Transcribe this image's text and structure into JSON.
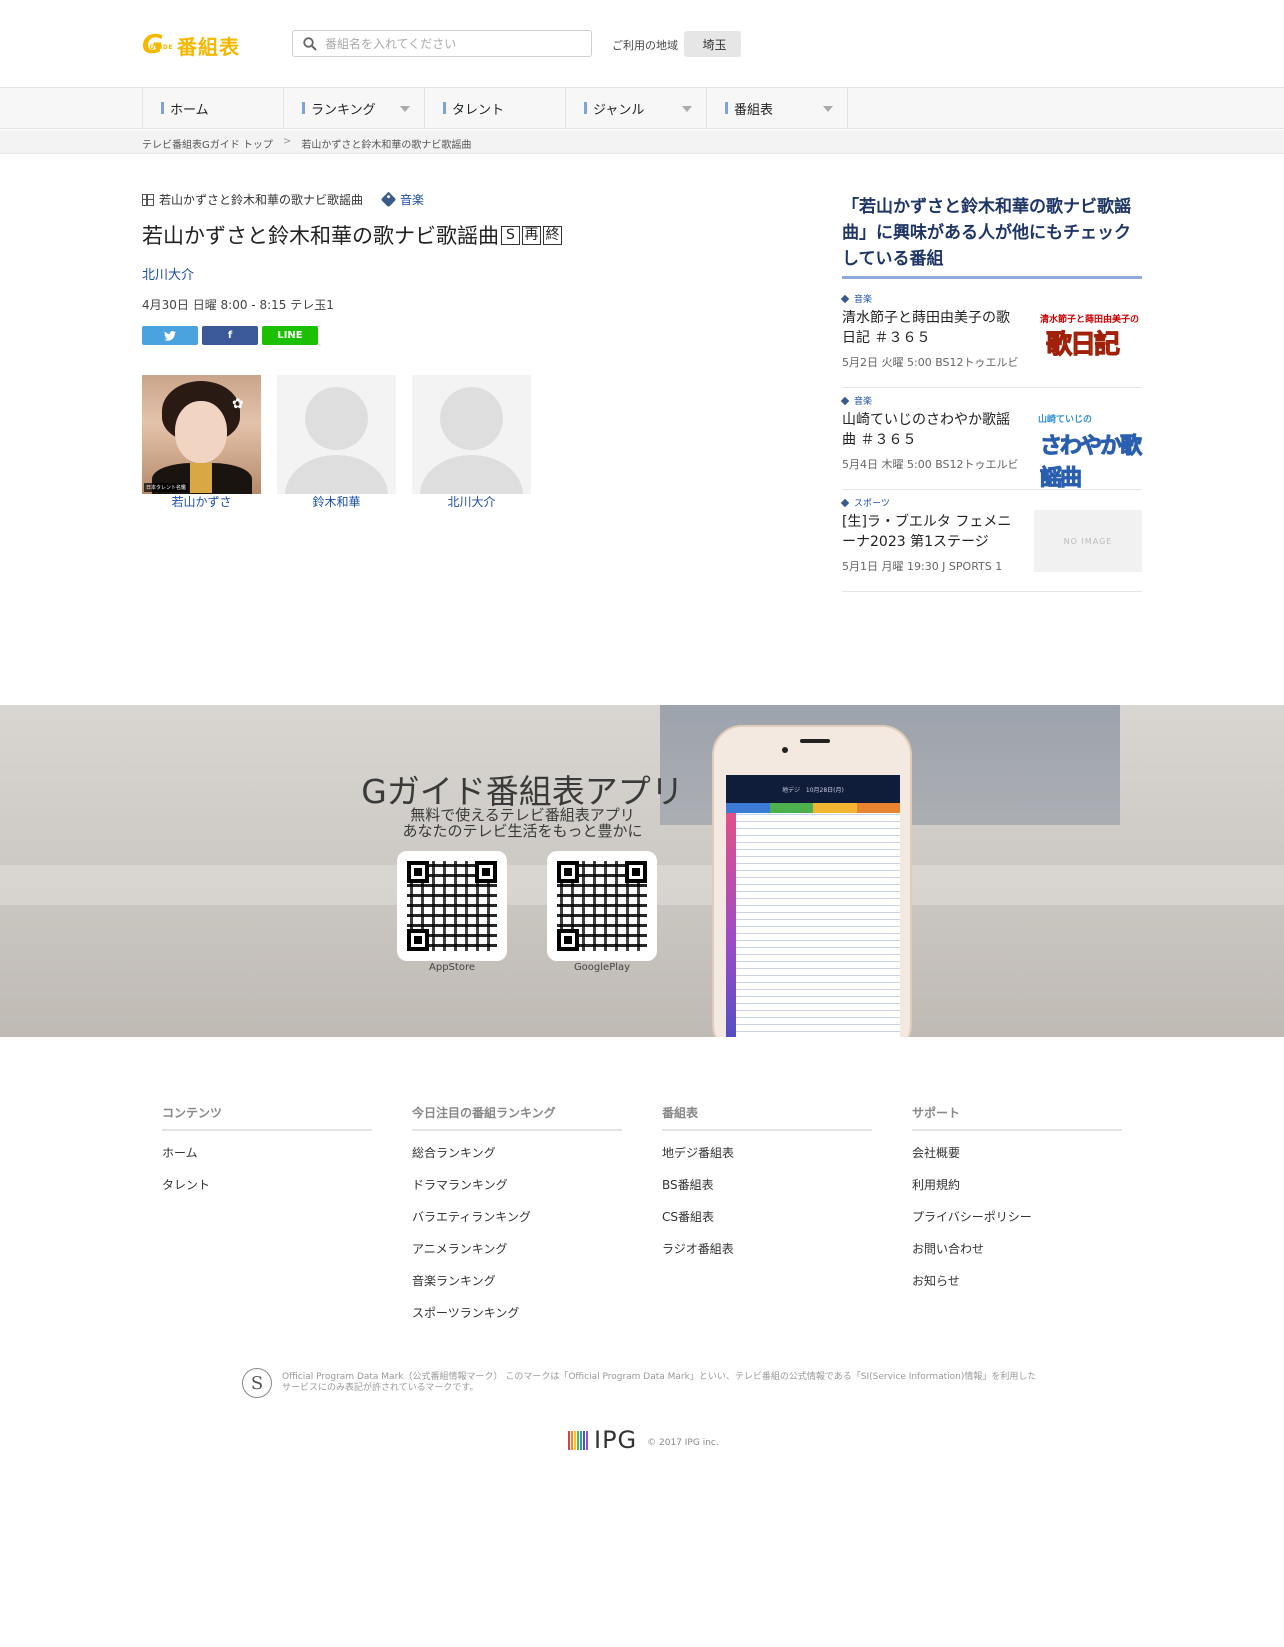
{
  "header": {
    "logo_mark": "G",
    "logo_guide": "GUIDE",
    "logo_text": "番組表",
    "search_placeholder": "番組名を入れてください",
    "region_label": "ご利用の地域",
    "region_value": "埼玉"
  },
  "nav": {
    "items": [
      {
        "label": "ホーム",
        "dropdown": false
      },
      {
        "label": "ランキング",
        "dropdown": true
      },
      {
        "label": "タレント",
        "dropdown": false
      },
      {
        "label": "ジャンル",
        "dropdown": true
      },
      {
        "label": "番組表",
        "dropdown": true
      }
    ]
  },
  "breadcrumb": {
    "home": "テレビ番組表Gガイド トップ",
    "sep": ">",
    "current": "若山かずさと鈴木和華の歌ナビ歌謡曲"
  },
  "program": {
    "series": "若山かずさと鈴木和華の歌ナビ歌謡曲",
    "genre": "音楽",
    "title": "若山かずさと鈴木和華の歌ナビ歌謡曲",
    "marks": [
      "S",
      "再",
      "終"
    ],
    "cast_link": "北川大介",
    "airtime": "4月30日 日曜 8:00  - 8:15 テレ玉1",
    "share": {
      "twitter": "twitter-icon",
      "facebook": "f",
      "line": "LINE"
    },
    "cast": [
      {
        "name": "若山かずさ",
        "photo_credit": "日本タレント名鑑"
      },
      {
        "name": "鈴木和華"
      },
      {
        "name": "北川大介"
      }
    ]
  },
  "sidebar": {
    "heading": "「若山かずさと鈴木和華の歌ナビ歌謡曲」に興味がある人が他にもチェックしている番組",
    "items": [
      {
        "genre": "音楽",
        "title": "清水節子と蒔田由美子の歌日記 ＃３６５",
        "time": "5月2日 火曜 5:00 BS12トゥエルビ",
        "thumb_top": "清水節子と蒔田由美子の",
        "thumb_main": "歌日記"
      },
      {
        "genre": "音楽",
        "title": "山崎ていじのさわやか歌謡曲 ＃３６５",
        "time": "5月4日 木曜 5:00 BS12トゥエルビ",
        "thumb_top": "山崎ていじの",
        "thumb_main": "さわやか歌謡曲"
      },
      {
        "genre": "スポーツ",
        "title": "[生]ラ・ブエルタ フェメニーナ2023 第1ステージ（チ…",
        "time": "5月1日 月曜 19:30 J SPORTS 1",
        "thumb_text": "NO IMAGE"
      }
    ]
  },
  "app_promo": {
    "title": "Gガイド番組表アプリ",
    "subtitle_1": "無料で使えるテレビ番組表アプリ",
    "subtitle_2": "あなたのテレビ生活をもっと豊かに",
    "qr_1_label": "AppStore",
    "qr_2_label": "GooglePlay",
    "phone_tab": "地デジ",
    "phone_date": "10月28日(月)"
  },
  "footer": {
    "columns": [
      {
        "heading": "コンテンツ",
        "links": [
          "ホーム",
          "タレント"
        ]
      },
      {
        "heading": "今日注目の番組ランキング",
        "links": [
          "総合ランキング",
          "ドラマランキング",
          "バラエティランキング",
          "アニメランキング",
          "音楽ランキング",
          "スポーツランキング"
        ]
      },
      {
        "heading": "番組表",
        "links": [
          "地デジ番組表",
          "BS番組表",
          "CS番組表",
          "ラジオ番組表"
        ]
      },
      {
        "heading": "サポート",
        "links": [
          "会社概要",
          "利用規約",
          "プライバシーポリシー",
          "お問い合わせ",
          "お知らせ"
        ]
      }
    ],
    "si_mark": "S",
    "si_text": "Official Program Data Mark（公式番組情報マーク） このマークは「Official Program Data Mark」といい、テレビ番組の公式情報である「SI(Service Information)情報」を利用したサービスにのみ表記が許されているマークです。",
    "ipg_logo": "IPG",
    "copyright": "© 2017 IPG inc."
  },
  "colors": {
    "brand": "#f5b800",
    "link": "#1d4fa8",
    "nav_accent": "#7fa2d8",
    "twitter": "#4aa3df",
    "facebook": "#3b5998",
    "line": "#1bc100"
  }
}
